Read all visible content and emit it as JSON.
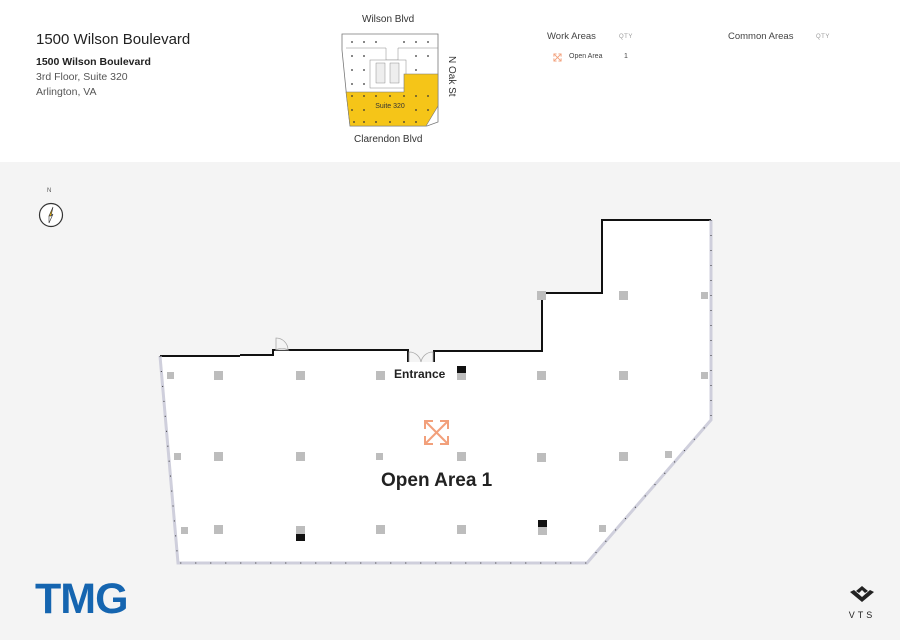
{
  "header": {
    "title": "1500 Wilson Boulevard",
    "building_name": "1500 Wilson Boulevard",
    "floor_suite": "3rd Floor, Suite 320",
    "city_state": "Arlington, VA"
  },
  "keyplan": {
    "north_street": "Wilson Blvd",
    "east_street": "N Oak St",
    "south_street": "Clarendon Blvd",
    "suite_label": "Suite 320",
    "highlight_color": "#f5c518"
  },
  "legend": {
    "work_areas_heading": "Work Areas",
    "work_qty_heading": "QTY",
    "common_areas_heading": "Common Areas",
    "common_qty_heading": "QTY",
    "work_items": [
      {
        "icon": "expand-arrows-icon",
        "label": "Open Area",
        "qty": "1"
      }
    ],
    "icon_color": "#f2a07b"
  },
  "compass": {
    "label": "N"
  },
  "floorplan": {
    "entrance_label": "Entrance",
    "area_label": "Open Area 1",
    "area_icon": "expand-arrows-icon"
  },
  "branding": {
    "tenant_logo": "TMG",
    "tenant_color": "#1565b0",
    "platform_logo": "VTS"
  }
}
